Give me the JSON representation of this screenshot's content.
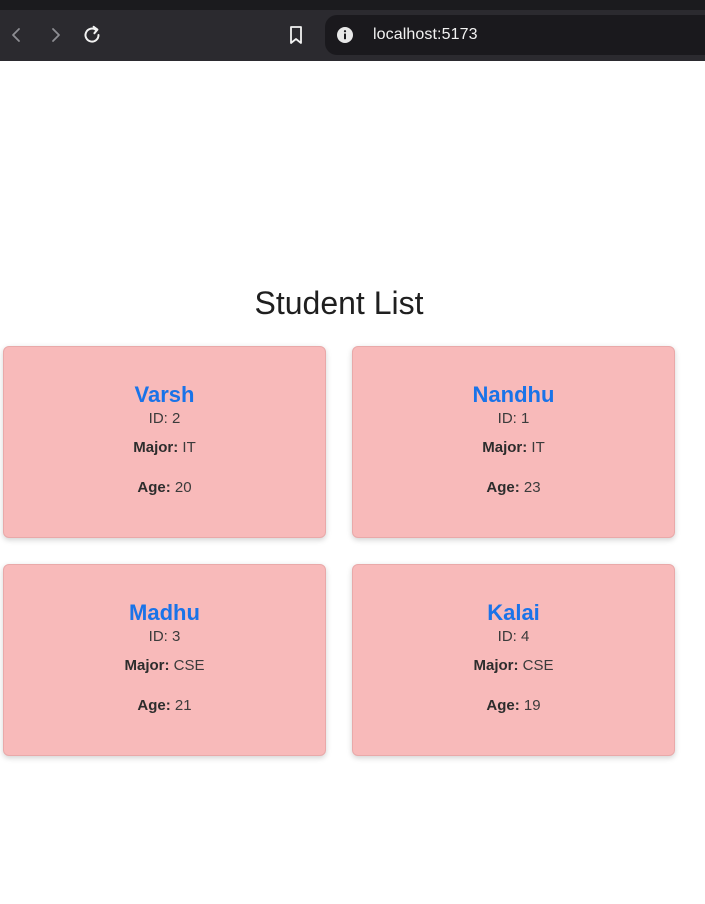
{
  "browser": {
    "url": "localhost:5173",
    "icons": {
      "back": "back-arrow-icon",
      "forward": "forward-arrow-icon",
      "reload": "reload-icon",
      "bookmark": "bookmark-icon",
      "site_info": "info-icon"
    }
  },
  "page": {
    "title": "Student List",
    "labels": {
      "id_prefix": "ID: ",
      "major": "Major:",
      "age": "Age:"
    },
    "students": [
      {
        "name": "Varsh",
        "id": "2",
        "major": "IT",
        "age": "20"
      },
      {
        "name": "Nandhu",
        "id": "1",
        "major": "IT",
        "age": "23"
      },
      {
        "name": "Madhu",
        "id": "3",
        "major": "CSE",
        "age": "21"
      },
      {
        "name": "Kalai",
        "id": "4",
        "major": "CSE",
        "age": "19"
      }
    ]
  },
  "colors": {
    "card_background": "#f8baba",
    "name_color": "#1a73e8",
    "browser_chrome": "#2b2a2f"
  }
}
